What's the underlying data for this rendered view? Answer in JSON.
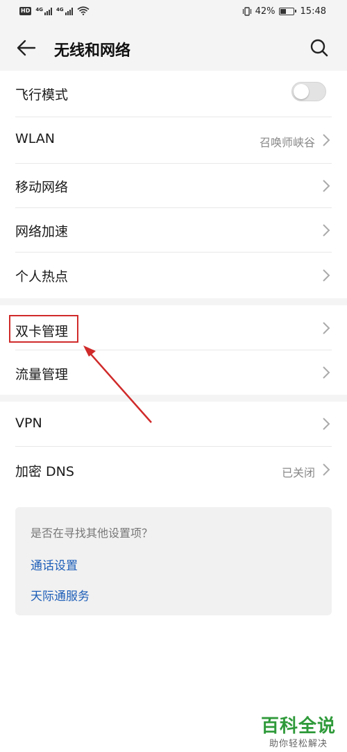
{
  "status_bar": {
    "hd_badge": "HD",
    "net1": "4G",
    "net2": "4G",
    "battery": "42%",
    "time": "15:48"
  },
  "header": {
    "title": "无线和网络"
  },
  "groups": [
    {
      "items": [
        {
          "label": "飞行模式",
          "type": "toggle",
          "value": "",
          "on": false
        },
        {
          "label": "WLAN",
          "type": "nav",
          "value": "召唤师峡谷"
        },
        {
          "label": "移动网络",
          "type": "nav",
          "value": ""
        },
        {
          "label": "网络加速",
          "type": "nav",
          "value": ""
        },
        {
          "label": "个人热点",
          "type": "nav",
          "value": ""
        }
      ]
    },
    {
      "items": [
        {
          "label": "双卡管理",
          "type": "nav",
          "value": "",
          "highlighted": true
        },
        {
          "label": "流量管理",
          "type": "nav",
          "value": ""
        }
      ]
    },
    {
      "items": [
        {
          "label": "VPN",
          "type": "nav",
          "value": ""
        },
        {
          "label": "加密 DNS",
          "type": "nav",
          "value": "已关闭"
        }
      ]
    }
  ],
  "suggestions": {
    "question": "是否在寻找其他设置项？",
    "links": [
      "通话设置",
      "天际通服务"
    ]
  },
  "watermark": {
    "main": "百科全说",
    "sub": "助你轻松解决"
  },
  "colors": {
    "link": "#1d5eb8",
    "annotation": "#d02a2a",
    "watermark": "#2f9a3a"
  }
}
